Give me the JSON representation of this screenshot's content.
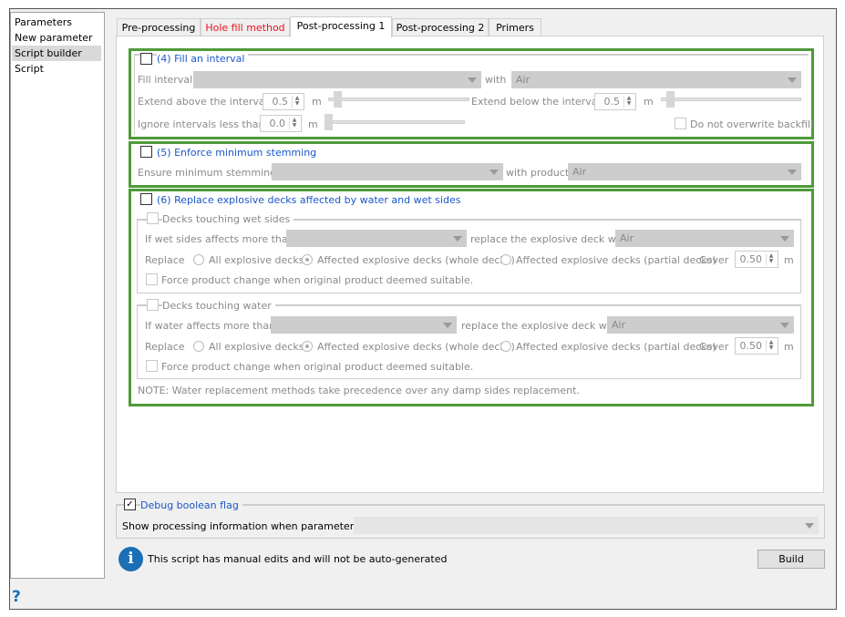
{
  "sidebar": {
    "items": [
      "Parameters",
      "New parameter",
      "Script builder",
      "Script"
    ],
    "selected": "Script builder"
  },
  "tabs": [
    "Pre-processing",
    "Hole fill method",
    "Post-processing 1",
    "Post-processing 2",
    "Primers"
  ],
  "active_tab": "Post-processing 1",
  "fill": {
    "title": "(4) Fill an interval",
    "fill_interval": "Fill interval",
    "with": "with",
    "with_value": "Air",
    "extend_above": "Extend above the interval",
    "above_value": "0.5",
    "unit": "m",
    "extend_below": "Extend below the interval",
    "below_value": "0.5",
    "ignore": "Ignore intervals less than",
    "ignore_value": "0.0",
    "no_overwrite": "Do not overwrite backfill"
  },
  "stemming": {
    "title": "(5) Enforce minimum stemming",
    "ensure": "Ensure minimum stemming of",
    "with_product": "with product",
    "product_value": "Air"
  },
  "replace": {
    "title": "(6) Replace explosive decks affected by water and wet sides",
    "wet": {
      "title": "Decks touching wet sides",
      "if": "If wet sides affects more than",
      "replace_with": "replace the explosive deck with",
      "product": "Air",
      "replace": "Replace",
      "opt_all": "All explosive decks",
      "opt_whole": "Affected explosive decks (whole decks)",
      "opt_partial": "Affected explosive decks (partial decks)",
      "cover": "Cover",
      "cover_value": "0.50",
      "unit": "m",
      "force": "Force product change when original product deemed suitable."
    },
    "water": {
      "title": "Decks touching water",
      "if": "If water affects more than",
      "replace_with": "replace the explosive deck with",
      "product": "Air",
      "replace": "Replace",
      "opt_all": "All explosive decks",
      "opt_whole": "Affected explosive decks (whole decks)",
      "opt_partial": "Affected explosive decks (partial decks)",
      "cover": "Cover",
      "cover_value": "0.50",
      "unit": "m",
      "force": "Force product change when original product deemed suitable."
    },
    "note": "NOTE: Water replacement methods take precedence over any damp sides replacement."
  },
  "debug": {
    "title": "Debug boolean flag",
    "show_info": "Show processing information when parameter is set"
  },
  "footer": {
    "info": "This script has manual edits and will not be auto-generated",
    "build": "Build",
    "help": "?"
  }
}
